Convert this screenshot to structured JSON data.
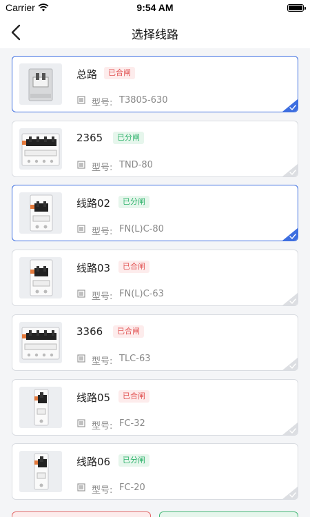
{
  "status_bar": {
    "carrier": "Carrier",
    "time": "9:54 AM"
  },
  "header": {
    "title": "选择线路"
  },
  "model_label": "型号:",
  "colors": {
    "accent": "#3d6ee0",
    "closed": "#e25555",
    "open": "#2fb36c"
  },
  "circuits": [
    {
      "name": "总路",
      "status": "已合闸",
      "status_type": "closed",
      "model": "T3805-630",
      "selected": true,
      "device": "breaker-2pole-grey"
    },
    {
      "name": "2365",
      "status": "已分闸",
      "status_type": "open",
      "model": "TND-80",
      "selected": false,
      "device": "breaker-4pole"
    },
    {
      "name": "线路02",
      "status": "已分闸",
      "status_type": "open",
      "model": "FN(L)C-80",
      "selected": true,
      "device": "breaker-2pole"
    },
    {
      "name": "线路03",
      "status": "已合闸",
      "status_type": "closed",
      "model": "FN(L)C-63",
      "selected": false,
      "device": "breaker-2pole"
    },
    {
      "name": "3366",
      "status": "已合闸",
      "status_type": "closed",
      "model": "TLC-63",
      "selected": false,
      "device": "breaker-4pole"
    },
    {
      "name": "线路05",
      "status": "已合闸",
      "status_type": "closed",
      "model": "FC-32",
      "selected": false,
      "device": "breaker-1pole"
    },
    {
      "name": "线路06",
      "status": "已分闸",
      "status_type": "open",
      "model": "FC-20",
      "selected": false,
      "device": "breaker-1pole"
    }
  ]
}
